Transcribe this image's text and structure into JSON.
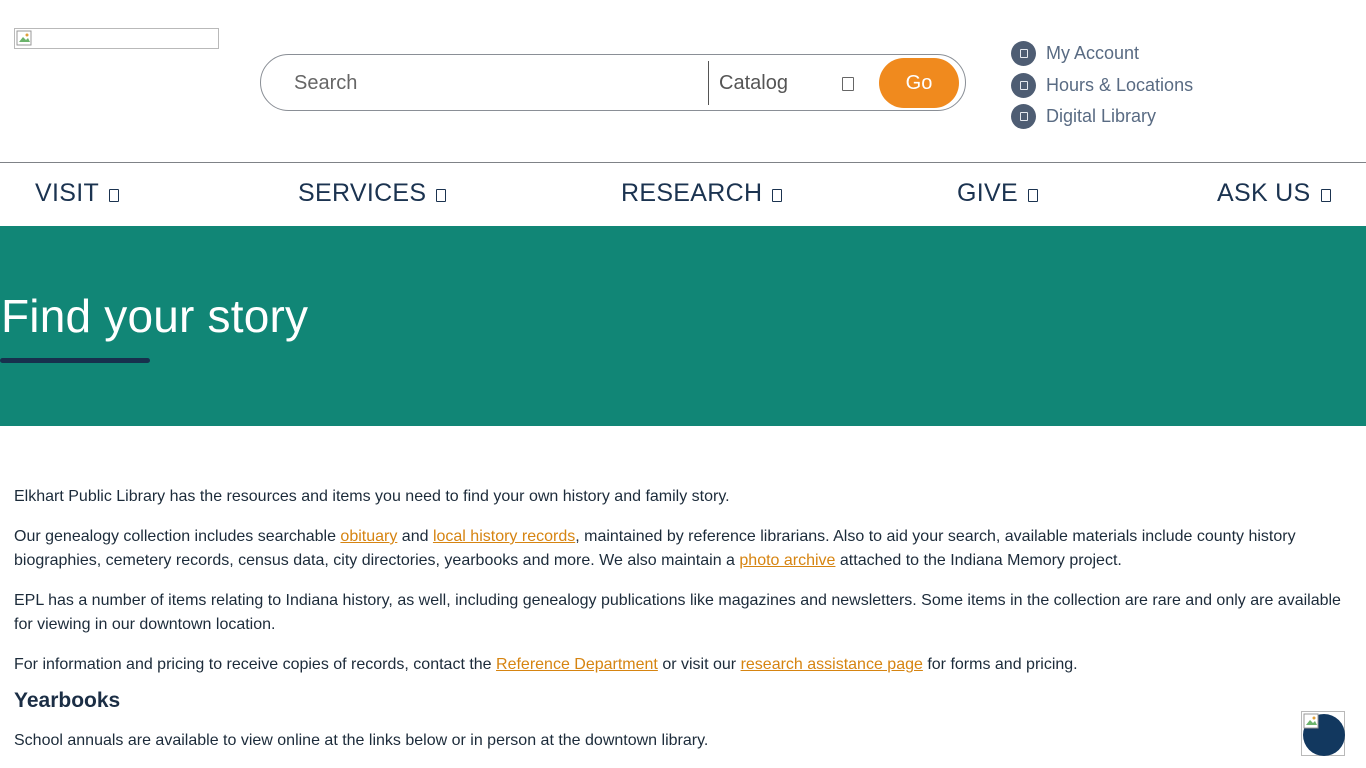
{
  "header": {
    "logo_alt": "",
    "search": {
      "placeholder": "Search",
      "value": ""
    },
    "catalog_select": {
      "selected": "Catalog"
    },
    "go_label": "Go",
    "utility_links": [
      {
        "label": "My Account",
        "icon": "account-icon"
      },
      {
        "label": "Hours & Locations",
        "icon": "location-icon"
      },
      {
        "label": "Digital Library",
        "icon": "digital-library-icon"
      }
    ]
  },
  "nav": {
    "items": [
      {
        "label": "VISIT"
      },
      {
        "label": "SERVICES"
      },
      {
        "label": "RESEARCH"
      },
      {
        "label": "GIVE"
      },
      {
        "label": "ASK US"
      }
    ]
  },
  "hero": {
    "title": "Find your story",
    "color": "#118676"
  },
  "content": {
    "p1": "Elkhart Public Library has the resources and items you need to find your own history and family story.",
    "p2": {
      "t1": "Our genealogy collection includes searchable ",
      "link1": "obituary",
      "t2": " and ",
      "link2": "local history records",
      "t3": ", maintained by reference librarians. Also to aid your search, available materials include county history biographies, cemetery records, census data, city directories, yearbooks and more. We also maintain a ",
      "link3": "photo archive",
      "t4": " attached to the Indiana Memory project."
    },
    "p3": "EPL has a number of items relating to Indiana history, as well, including genealogy publications like magazines and newsletters. Some items in the collection are rare and only are available for viewing in our downtown location.",
    "p4": {
      "t1": "For information and pricing to receive copies of records, contact the ",
      "link1": "Reference Department",
      "t2": " or visit our ",
      "link2": "research assistance page",
      "t3": " for forms and pricing."
    },
    "h2": "Yearbooks",
    "p5": "School annuals are available to view online at the links below or in person at the downtown library."
  },
  "colors": {
    "accent_orange": "#f08a1e",
    "link": "#d68411",
    "nav_text": "#1b3350",
    "hero_underline": "#17304d"
  }
}
